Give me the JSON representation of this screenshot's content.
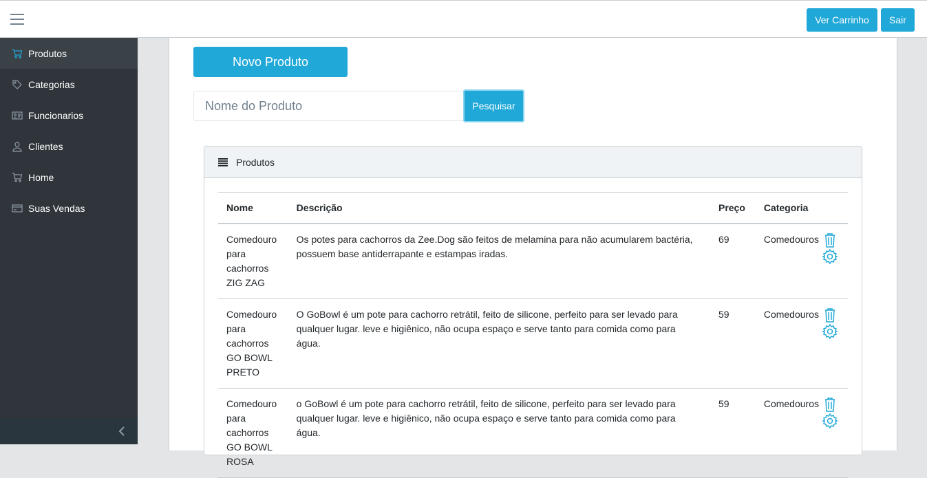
{
  "header": {
    "menu_icon": "hamburger-icon",
    "cart_label": "Ver Carrinho",
    "logout_label": "Sair"
  },
  "sidebar": {
    "items": [
      {
        "label": "Produtos",
        "icon": "cart-icon",
        "active": true
      },
      {
        "label": "Categorias",
        "icon": "tag-icon",
        "active": false
      },
      {
        "label": "Funcionarios",
        "icon": "id-card-icon",
        "active": false
      },
      {
        "label": "Clientes",
        "icon": "user-icon",
        "active": false
      },
      {
        "label": "Home",
        "icon": "cart-icon",
        "active": false
      },
      {
        "label": "Suas Vendas",
        "icon": "credit-card-icon",
        "active": false
      }
    ],
    "minimizer_icon": "chevron-left-icon"
  },
  "main": {
    "new_product_label": "Novo Produto",
    "search_placeholder": "Nome do Produto",
    "search_button": "Pesquisar"
  },
  "panel": {
    "title": "Produtos",
    "columns": [
      "Nome",
      "Descrição",
      "Preço",
      "Categoria"
    ],
    "rows": [
      {
        "nome": "Comedouro para cachorros ZIG ZAG",
        "descricao": "Os potes para cachorros da Zee.Dog são feitos de melamina para não acumularem bactéria, possuem base antiderrapante e estampas iradas.",
        "preco": "69",
        "categoria": "Comedouros"
      },
      {
        "nome": "Comedouro para cachorros GO BOWL PRETO",
        "descricao": "O GoBowl é um pote para cachorro retrátil, feito de silicone, perfeito para ser levado para qualquer lugar. leve e higiênico, não ocupa espaço e serve tanto para comida como para água.",
        "preco": "59",
        "categoria": "Comedouros"
      },
      {
        "nome": "Comedouro para cachorros GO BOWL ROSA",
        "descricao": "o GoBowl é um pote para cachorro retrátil, feito de silicone, perfeito para ser levado para qualquer lugar. leve e higiênico, não ocupa espaço e serve tanto para comida como para água.",
        "preco": "59",
        "categoria": "Comedouros"
      }
    ]
  },
  "colors": {
    "primary": "#20a8d8",
    "sidebar_bg": "#2f353a",
    "sidebar_active": "#3a4248",
    "page_bg": "#e4e5e6"
  }
}
